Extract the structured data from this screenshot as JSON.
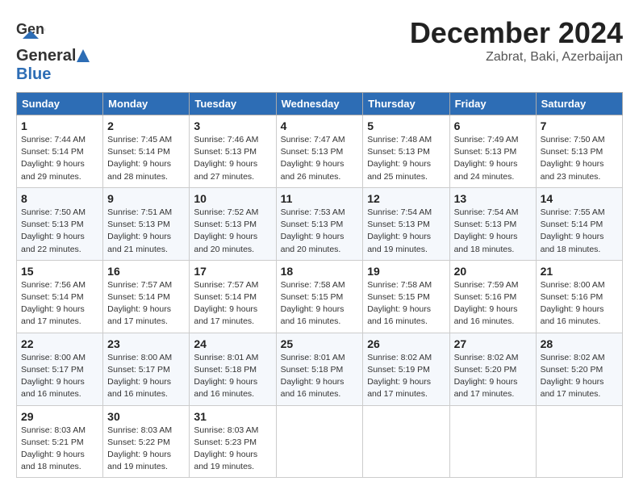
{
  "header": {
    "logo_general": "General",
    "logo_blue": "Blue",
    "month": "December 2024",
    "location": "Zabrat, Baki, Azerbaijan"
  },
  "weekdays": [
    "Sunday",
    "Monday",
    "Tuesday",
    "Wednesday",
    "Thursday",
    "Friday",
    "Saturday"
  ],
  "weeks": [
    [
      {
        "day": 1,
        "sunrise": "7:44 AM",
        "sunset": "5:14 PM",
        "daylight": "9 hours and 29 minutes."
      },
      {
        "day": 2,
        "sunrise": "7:45 AM",
        "sunset": "5:14 PM",
        "daylight": "9 hours and 28 minutes."
      },
      {
        "day": 3,
        "sunrise": "7:46 AM",
        "sunset": "5:13 PM",
        "daylight": "9 hours and 27 minutes."
      },
      {
        "day": 4,
        "sunrise": "7:47 AM",
        "sunset": "5:13 PM",
        "daylight": "9 hours and 26 minutes."
      },
      {
        "day": 5,
        "sunrise": "7:48 AM",
        "sunset": "5:13 PM",
        "daylight": "9 hours and 25 minutes."
      },
      {
        "day": 6,
        "sunrise": "7:49 AM",
        "sunset": "5:13 PM",
        "daylight": "9 hours and 24 minutes."
      },
      {
        "day": 7,
        "sunrise": "7:50 AM",
        "sunset": "5:13 PM",
        "daylight": "9 hours and 23 minutes."
      }
    ],
    [
      {
        "day": 8,
        "sunrise": "7:50 AM",
        "sunset": "5:13 PM",
        "daylight": "9 hours and 22 minutes."
      },
      {
        "day": 9,
        "sunrise": "7:51 AM",
        "sunset": "5:13 PM",
        "daylight": "9 hours and 21 minutes."
      },
      {
        "day": 10,
        "sunrise": "7:52 AM",
        "sunset": "5:13 PM",
        "daylight": "9 hours and 20 minutes."
      },
      {
        "day": 11,
        "sunrise": "7:53 AM",
        "sunset": "5:13 PM",
        "daylight": "9 hours and 20 minutes."
      },
      {
        "day": 12,
        "sunrise": "7:54 AM",
        "sunset": "5:13 PM",
        "daylight": "9 hours and 19 minutes."
      },
      {
        "day": 13,
        "sunrise": "7:54 AM",
        "sunset": "5:13 PM",
        "daylight": "9 hours and 18 minutes."
      },
      {
        "day": 14,
        "sunrise": "7:55 AM",
        "sunset": "5:14 PM",
        "daylight": "9 hours and 18 minutes."
      }
    ],
    [
      {
        "day": 15,
        "sunrise": "7:56 AM",
        "sunset": "5:14 PM",
        "daylight": "9 hours and 17 minutes."
      },
      {
        "day": 16,
        "sunrise": "7:57 AM",
        "sunset": "5:14 PM",
        "daylight": "9 hours and 17 minutes."
      },
      {
        "day": 17,
        "sunrise": "7:57 AM",
        "sunset": "5:14 PM",
        "daylight": "9 hours and 17 minutes."
      },
      {
        "day": 18,
        "sunrise": "7:58 AM",
        "sunset": "5:15 PM",
        "daylight": "9 hours and 16 minutes."
      },
      {
        "day": 19,
        "sunrise": "7:58 AM",
        "sunset": "5:15 PM",
        "daylight": "9 hours and 16 minutes."
      },
      {
        "day": 20,
        "sunrise": "7:59 AM",
        "sunset": "5:16 PM",
        "daylight": "9 hours and 16 minutes."
      },
      {
        "day": 21,
        "sunrise": "8:00 AM",
        "sunset": "5:16 PM",
        "daylight": "9 hours and 16 minutes."
      }
    ],
    [
      {
        "day": 22,
        "sunrise": "8:00 AM",
        "sunset": "5:17 PM",
        "daylight": "9 hours and 16 minutes."
      },
      {
        "day": 23,
        "sunrise": "8:00 AM",
        "sunset": "5:17 PM",
        "daylight": "9 hours and 16 minutes."
      },
      {
        "day": 24,
        "sunrise": "8:01 AM",
        "sunset": "5:18 PM",
        "daylight": "9 hours and 16 minutes."
      },
      {
        "day": 25,
        "sunrise": "8:01 AM",
        "sunset": "5:18 PM",
        "daylight": "9 hours and 16 minutes."
      },
      {
        "day": 26,
        "sunrise": "8:02 AM",
        "sunset": "5:19 PM",
        "daylight": "9 hours and 17 minutes."
      },
      {
        "day": 27,
        "sunrise": "8:02 AM",
        "sunset": "5:20 PM",
        "daylight": "9 hours and 17 minutes."
      },
      {
        "day": 28,
        "sunrise": "8:02 AM",
        "sunset": "5:20 PM",
        "daylight": "9 hours and 17 minutes."
      }
    ],
    [
      {
        "day": 29,
        "sunrise": "8:03 AM",
        "sunset": "5:21 PM",
        "daylight": "9 hours and 18 minutes."
      },
      {
        "day": 30,
        "sunrise": "8:03 AM",
        "sunset": "5:22 PM",
        "daylight": "9 hours and 19 minutes."
      },
      {
        "day": 31,
        "sunrise": "8:03 AM",
        "sunset": "5:23 PM",
        "daylight": "9 hours and 19 minutes."
      },
      null,
      null,
      null,
      null
    ]
  ]
}
